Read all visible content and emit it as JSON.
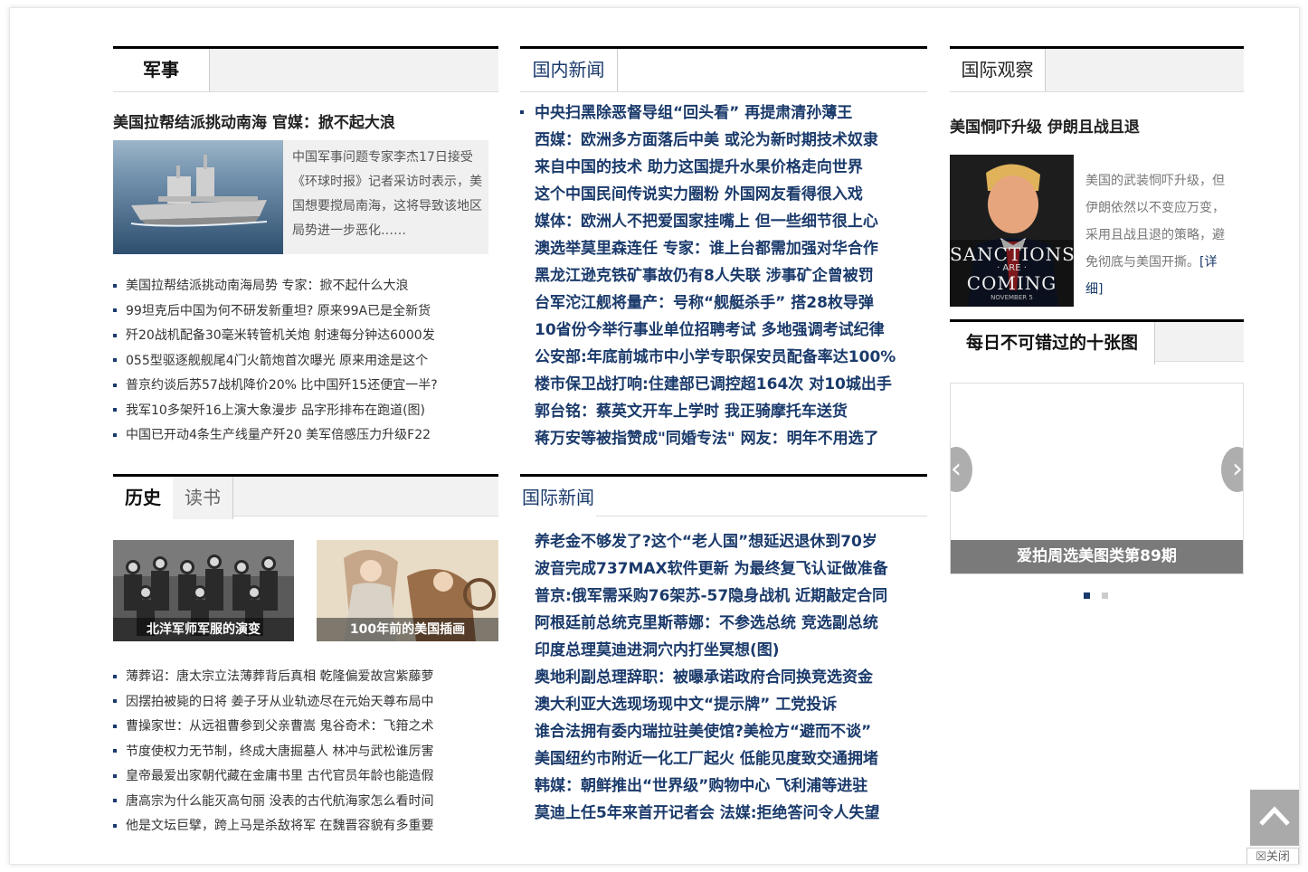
{
  "military": {
    "tab": "军事",
    "headline": "美国拉帮结派挑动南海 官媒：掀不起大浪",
    "intro": "中国军事问题专家李杰17日接受《环球时报》记者采访时表示，美国想要搅局南海，这将导致该地区局势进一步恶化……",
    "items": [
      "美国拉帮结派挑动南海局势 专家：掀不起什么大浪",
      "99坦克后中国为何不研发新重坦? 原来99A已是全新货",
      "歼20战机配备30毫米转管机关炮 射速每分钟达6000发",
      "055型驱逐舰舰尾4门火箭炮首次曝光 原来用途是这个",
      "普京约谈后苏57战机降价20% 比中国歼15还便宜一半?",
      "我军10多架歼16上演大象漫步 品字形排布在跑道(图)",
      "中国已开动4条生产线量产歼20 美军倍感压力升级F22"
    ]
  },
  "history": {
    "tabs": [
      "历史",
      "读书"
    ],
    "photos": [
      "北洋军师军服的演变",
      "100年前的美国插画"
    ],
    "items": [
      "薄葬诏：唐太宗立法薄葬背后真相 乾隆偏爱故宫紫藤萝",
      "因摆拍被毙的日将 姜子牙从业轨迹尽在元始天尊布局中",
      "曹操家世：从远祖曹参到父亲曹嵩 鬼谷奇术：飞箝之术",
      "节度使权力无节制，终成大唐掘墓人 林冲与武松谁厉害",
      "皇帝最爱出家朝代藏在金庸书里 古代官员年龄也能造假",
      "唐高宗为什么能灭高句丽 没表的古代航海家怎么看时间",
      "他是文坛巨擘，跨上马是杀敌将军 在魏晋容貌有多重要"
    ]
  },
  "domestic": {
    "tab": "国内新闻",
    "items": [
      "中央扫黑除恶督导组“回头看” 再提肃清孙薄王",
      "西媒：欧洲多方面落后中美 或沦为新时期技术奴隶",
      "来自中国的技术 助力这国提升水果价格走向世界",
      "这个中国民间传说实力圈粉 外国网友看得很入戏",
      "媒体：欧洲人不把爱国家挂嘴上 但一些细节很上心",
      "澳选举莫里森连任 专家：谁上台都需加强对华合作",
      "黑龙江逊克铁矿事故仍有8人失联 涉事矿企曾被罚",
      "台军沱江舰将量产：号称“舰艇杀手” 搭28枚导弹",
      "10省份今举行事业单位招聘考试 多地强调考试纪律",
      "公安部:年底前城市中小学专职保安员配备率达100%",
      "楼市保卫战打响:住建部已调控超164次 对10城出手",
      "郭台铭：蔡英文开车上学时 我正骑摩托车送货",
      "蒋万安等被指赞成\"同婚专法\" 网友：明年不用选了"
    ]
  },
  "international": {
    "tab": "国际新闻",
    "items": [
      "养老金不够发了?这个“老人国”想延迟退休到70岁",
      "波音完成737MAX软件更新 为最终复飞认证做准备",
      "普京:俄军需采购76架苏-57隐身战机 近期敲定合同",
      "阿根廷前总统克里斯蒂娜：不参选总统 竞选副总统",
      "印度总理莫迪进洞穴内打坐冥想(图)",
      "奥地利副总理辞职：被曝承诺政府合同换竞选资金",
      "澳大利亚大选现场现中文“提示牌” 工党投诉",
      "谁合法拥有委内瑞拉驻美使馆?美检方“避而不谈”",
      "美国纽约市附近一化工厂起火 低能见度致交通拥堵",
      "韩媒：朝鲜推出“世界级”购物中心 飞利浦等进驻",
      "莫迪上任5年来首开记者会 法媒:拒绝答问令人失望"
    ]
  },
  "observe": {
    "tab": "国际观察",
    "headline": "美国恫吓升级 伊朗且战且退",
    "intro": "美国的武装恫吓升级，但伊朗依然以不变应万变，采用且战且退的策略，避免彻底与美国开撕。",
    "detail": "[详细]",
    "poster_line1": "SANCTIONS",
    "poster_line2": "· ARE ·",
    "poster_line3": "COMING",
    "poster_line4": "NOVEMBER 5"
  },
  "gallery": {
    "tab": "每日不可错过的十张图",
    "caption": "爱拍周选美图类第89期",
    "prev": "‹",
    "next": "›"
  },
  "float": {
    "close": "☒关闭"
  },
  "colors": {
    "link_blue": "#1a3a6b",
    "dot_active": "#1a3a6b",
    "dot_inactive": "#cccccc"
  }
}
